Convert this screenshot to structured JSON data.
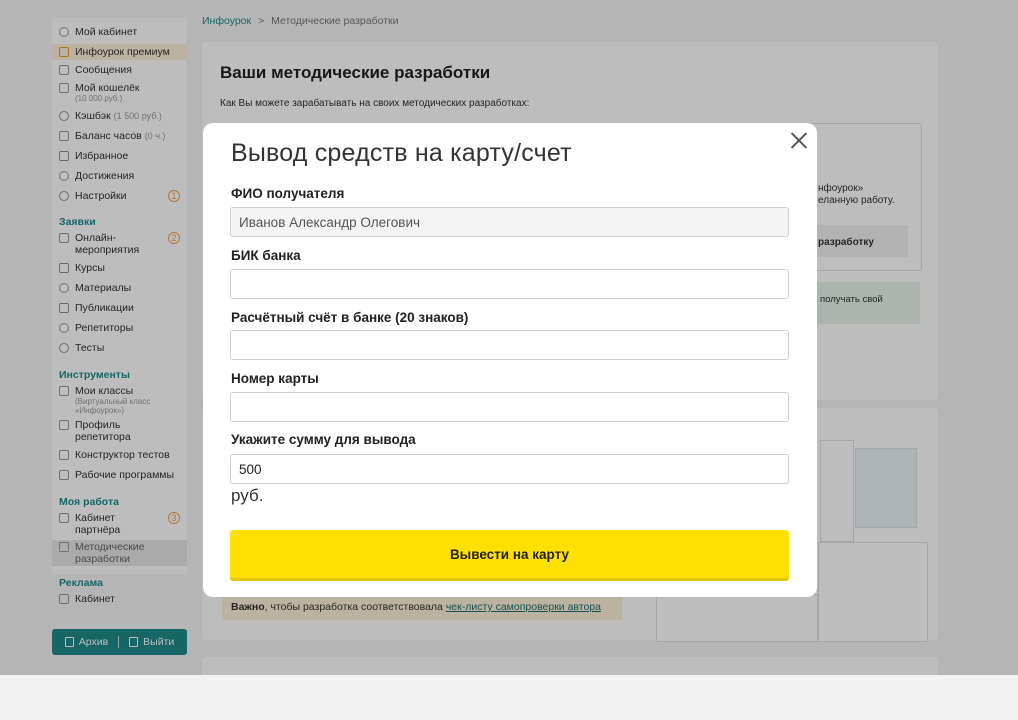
{
  "breadcrumb": {
    "home": "Инфоурок",
    "sep": ">",
    "current": "Методические разработки"
  },
  "sidebar": {
    "items": [
      {
        "label": "Мой кабинет"
      },
      {
        "label": "Инфоурок премиум"
      },
      {
        "label": "Сообщения"
      },
      {
        "label": "Мой кошелёк",
        "sub": "(10 000 руб.)"
      },
      {
        "label": "Кэшбэк",
        "extra": "(1 500 руб.)"
      },
      {
        "label": "Баланс часов",
        "extra": "(0 ч.)"
      },
      {
        "label": "Избранное"
      },
      {
        "label": "Достижения"
      },
      {
        "label": "Настройки",
        "badge": "1"
      }
    ],
    "section_requests": "Заявки",
    "requests": [
      {
        "label": "Онлайн-",
        "label2": "мероприятия",
        "badge": "2"
      },
      {
        "label": "Курсы"
      },
      {
        "label": "Материалы"
      },
      {
        "label": "Публикации"
      },
      {
        "label": "Репетиторы"
      },
      {
        "label": "Тесты"
      }
    ],
    "section_tools": "Инструменты",
    "tools": [
      {
        "label": "Мои классы",
        "sub1": "(Виртуальный класс",
        "sub2": "«Инфоурок»)"
      },
      {
        "label": "Профиль",
        "label2": "репетитора"
      },
      {
        "label": "Конструктор тестов"
      },
      {
        "label": "Рабочие программы"
      }
    ],
    "section_work": "Моя работа",
    "work": [
      {
        "label": "Кабинет",
        "label2": "партнёра",
        "badge": "3"
      },
      {
        "label": "Методические",
        "label2": "разработки"
      }
    ],
    "section_ads": "Реклама",
    "ads": [
      {
        "label": "Кабинет"
      }
    ],
    "archive_label": "Архив",
    "logout_label": "Выйти"
  },
  "main": {
    "title": "Ваши методические разработки",
    "intro": "Как Вы можете зарабатывать на своих методических разработках:",
    "frag1": "нфоурок»",
    "frag2": "еланную работу.",
    "frag3": "разработку",
    "frag4": "получать свой",
    "note_bold": "Важно",
    "note_text": ", чтобы разработка соответствовала ",
    "note_link": "чек-листу самопроверки автора"
  },
  "modal": {
    "title": "Вывод средств на карту/счет",
    "fio_label": "ФИО получателя",
    "fio_value": "Иванов Александр Олегович",
    "bik_label": "БИК банка",
    "bik_value": "",
    "account_label": "Расчётный счёт в банке (20 знаков)",
    "account_value": "",
    "card_label": "Номер карты",
    "card_value": "",
    "amount_label": "Укажите сумму для вывода",
    "amount_value": "500",
    "currency": "руб.",
    "submit_label": "Вывести на карту"
  },
  "colors": {
    "accent": "#1e8a8a",
    "button": "#ffe000",
    "badge": "#f0a050"
  }
}
